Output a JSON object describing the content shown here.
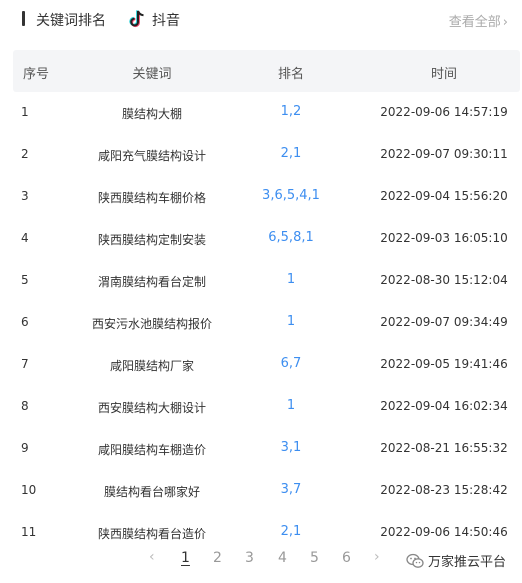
{
  "header": {
    "title": "关键词排名",
    "platform": "抖音",
    "view_all": "查看全部",
    "view_all_icon": "chevron-right-icon"
  },
  "table": {
    "columns": [
      "序号",
      "关键词",
      "排名",
      "时间"
    ],
    "rows": [
      {
        "idx": "1",
        "keyword": "膜结构大棚",
        "rank": "1,2",
        "time": "2022-09-06 14:57:19"
      },
      {
        "idx": "2",
        "keyword": "咸阳充气膜结构设计",
        "rank": "2,1",
        "time": "2022-09-07 09:30:11"
      },
      {
        "idx": "3",
        "keyword": "陕西膜结构车棚价格",
        "rank": "3,6,5,4,1",
        "time": "2022-09-04 15:56:20"
      },
      {
        "idx": "4",
        "keyword": "陕西膜结构定制安装",
        "rank": "6,5,8,1",
        "time": "2022-09-03 16:05:10"
      },
      {
        "idx": "5",
        "keyword": "渭南膜结构看台定制",
        "rank": "1",
        "time": "2022-08-30 15:12:04"
      },
      {
        "idx": "6",
        "keyword": "西安污水池膜结构报价",
        "rank": "1",
        "time": "2022-09-07 09:34:49"
      },
      {
        "idx": "7",
        "keyword": "咸阳膜结构厂家",
        "rank": "6,7",
        "time": "2022-09-05 19:41:46"
      },
      {
        "idx": "8",
        "keyword": "西安膜结构大棚设计",
        "rank": "1",
        "time": "2022-09-04 16:02:34"
      },
      {
        "idx": "9",
        "keyword": "咸阳膜结构车棚造价",
        "rank": "3,1",
        "time": "2022-08-21 16:55:32"
      },
      {
        "idx": "10",
        "keyword": "膜结构看台哪家好",
        "rank": "3,7",
        "time": "2022-08-23 15:28:42"
      },
      {
        "idx": "11",
        "keyword": "陕西膜结构看台造价",
        "rank": "2,1",
        "time": "2022-09-06 14:50:46"
      }
    ]
  },
  "pagination": {
    "prev": "‹",
    "next": "›",
    "pages": [
      "1",
      "2",
      "3",
      "4",
      "5",
      "6"
    ],
    "current": "1"
  },
  "watermark": {
    "text": "万家推云平台",
    "icon": "wechat-icon"
  },
  "colors": {
    "accent": "#3d8ef0",
    "header_bg": "#f4f5f7"
  }
}
